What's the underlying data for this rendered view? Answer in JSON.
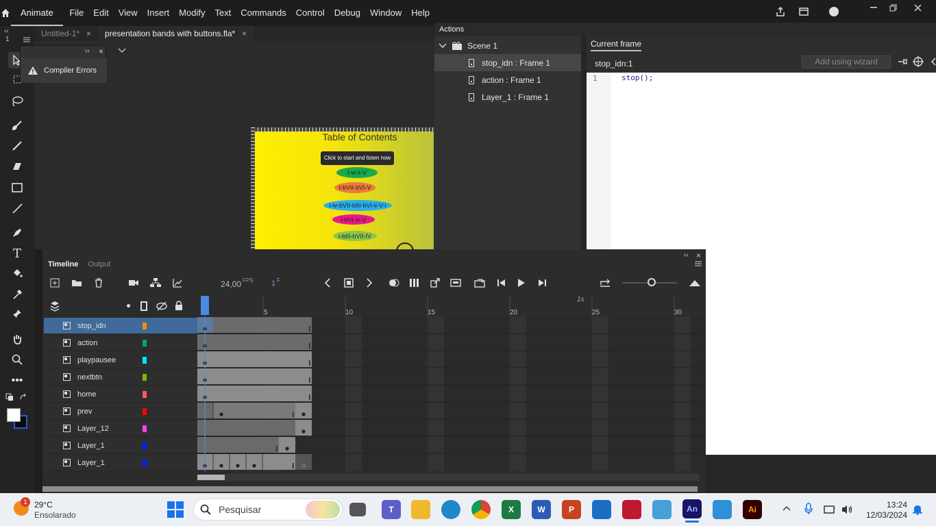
{
  "menubar": {
    "app_name": "Animate",
    "items": [
      "File",
      "Edit",
      "View",
      "Insert",
      "Modify",
      "Text",
      "Commands",
      "Control",
      "Debug",
      "Window",
      "Help"
    ]
  },
  "doc_tabs": [
    {
      "label": "Untitled-1*",
      "active": false
    },
    {
      "label": "presentation bands with buttons.fla*",
      "active": true
    }
  ],
  "compiler": {
    "label": "Compiler Errors"
  },
  "stage": {
    "title": "Table of Contents",
    "button_label": "Click to start and listen now",
    "ovals": [
      {
        "label": "I-vi-ii-V",
        "color": "#1aa84a"
      },
      {
        "label": "I-bVII-bVI-V",
        "color": "#f07a3a"
      },
      {
        "label": "i-iv-bVII-bIII-bVI-ii-V-i",
        "color": "#2ab0e8"
      },
      {
        "label": "i-bVI-iv-V",
        "color": "#e8198a"
      },
      {
        "label": "i-bIII-bVII-IV",
        "color": "#8cc84a"
      }
    ]
  },
  "actions": {
    "title": "Actions",
    "tree": [
      {
        "label": "Scene 1",
        "type": "scene"
      },
      {
        "label": "stop_idn : Frame 1",
        "type": "frame",
        "selected": true
      },
      {
        "label": "action : Frame 1",
        "type": "frame",
        "selected": false
      },
      {
        "label": "Layer_1 : Frame 1",
        "type": "frame",
        "selected": false
      }
    ],
    "tab": "Current frame",
    "frame_label": "stop_idn:1",
    "wizard_label": "Add using wizard",
    "code_line_number": "1",
    "code": "stop();"
  },
  "timeline": {
    "tabs": [
      "Timeline",
      "Output"
    ],
    "fps": "24,00",
    "fps_unit": "FPS",
    "current_frame": "1",
    "frame_unit": "F",
    "seconds_marker": "1s",
    "ruler_labels": [
      "5",
      "10",
      "15",
      "20",
      "25",
      "30"
    ],
    "layers": [
      {
        "name": "stop_idn",
        "color": "#ff8c00"
      },
      {
        "name": "action",
        "color": "#00a080"
      },
      {
        "name": "playpausee",
        "color": "#00e5ff"
      },
      {
        "name": "nextbtn",
        "color": "#7ab800"
      },
      {
        "name": "home",
        "color": "#ff5a5a"
      },
      {
        "name": "prev",
        "color": "#ff0000"
      },
      {
        "name": "Layer_12",
        "color": "#ff40ff"
      },
      {
        "name": "Layer_1",
        "color": "#0022ff"
      },
      {
        "name": "Layer_1",
        "color": "#0022ff"
      }
    ]
  },
  "taskbar": {
    "weather_temp": "29°C",
    "weather_desc": "Ensolarado",
    "weather_badge": "1",
    "search_placeholder": "Pesquisar",
    "time": "13:24",
    "date": "12/03/2024",
    "apps": [
      {
        "label": "",
        "color": "#0a6ad6"
      },
      {
        "label": "",
        "color": "#555555"
      },
      {
        "label": "T",
        "color": "#5b5fc7"
      },
      {
        "label": "",
        "color": "#f2b82d"
      },
      {
        "label": "",
        "color": "#1e88c8"
      },
      {
        "label": "",
        "color": "#2fa84f"
      },
      {
        "label": "X",
        "color": "#1d7a43"
      },
      {
        "label": "W",
        "color": "#2b5cb8"
      },
      {
        "label": "P",
        "color": "#c9421f"
      },
      {
        "label": "",
        "color": "#1a6fc4"
      },
      {
        "label": "",
        "color": "#c0182e"
      },
      {
        "label": "",
        "color": "#48a0d8"
      },
      {
        "label": "An",
        "color": "#1b1464"
      },
      {
        "label": "",
        "color": "#2f8fd8"
      },
      {
        "label": "Ai",
        "color": "#330000"
      }
    ]
  }
}
